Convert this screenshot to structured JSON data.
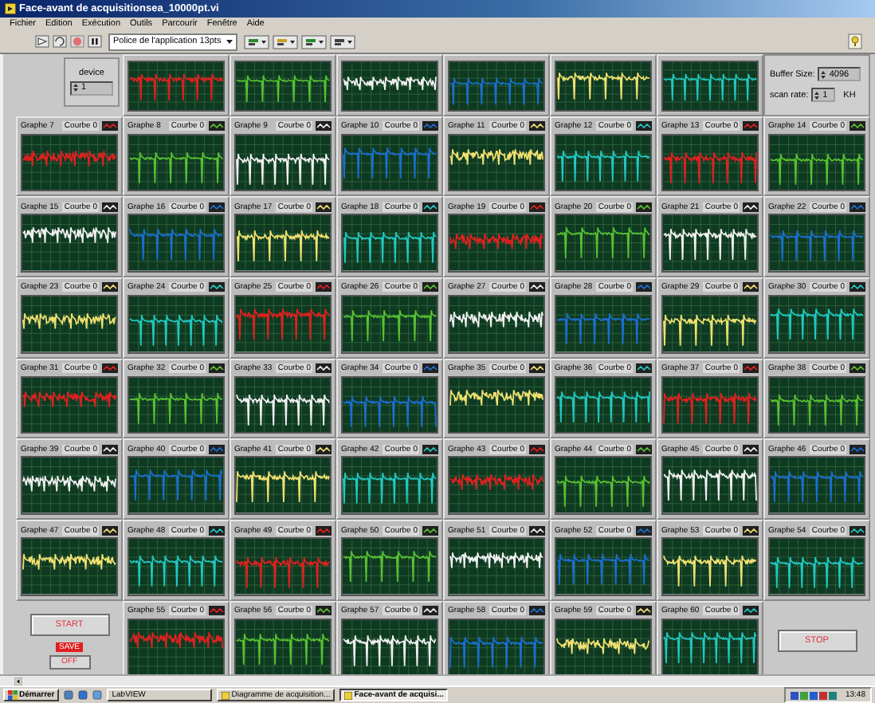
{
  "window": {
    "title": "Face-avant de acquisitionsea_10000pt.vi"
  },
  "menu": [
    "Fichier",
    "Edition",
    "Exécution",
    "Outils",
    "Parcourir",
    "Fenêtre",
    "Aide"
  ],
  "toolbar": {
    "font": "Police de l'application 13pts"
  },
  "device": {
    "label": "device",
    "value": "1"
  },
  "acquisition": {
    "buffer_label": "Buffer Size:",
    "buffer_value": "4096",
    "rate_label": "scan rate:",
    "rate_value": "1",
    "rate_unit": "KH"
  },
  "top_graphs": [
    {
      "color": "#e02020"
    },
    {
      "color": "#58c030"
    },
    {
      "color": "#f0f0f0"
    },
    {
      "color": "#1a6fd0"
    },
    {
      "color": "#f0e070"
    },
    {
      "color": "#20c8c0"
    }
  ],
  "graphs": [
    {
      "title": "Graphe 7",
      "legend": "Courbe 0",
      "color": "#e02020"
    },
    {
      "title": "Graphe 8",
      "legend": "Courbe 0",
      "color": "#58c030"
    },
    {
      "title": "Graphe 9",
      "legend": "Courbe 0",
      "color": "#f0f0f0"
    },
    {
      "title": "Graphe 10",
      "legend": "Courbe 0",
      "color": "#1a6fd0"
    },
    {
      "title": "Graphe 11",
      "legend": "Courbe 0",
      "color": "#f0e070"
    },
    {
      "title": "Graphe 12",
      "legend": "Courbe 0",
      "color": "#20c8c0"
    },
    {
      "title": "Graphe 13",
      "legend": "Courbe 0",
      "color": "#e02020"
    },
    {
      "title": "Graphe 14",
      "legend": "Courbe 0",
      "color": "#58c030"
    },
    {
      "title": "Graphe 15",
      "legend": "Courbe 0",
      "color": "#f0f0f0"
    },
    {
      "title": "Graphe 16",
      "legend": "Courbe 0",
      "color": "#1a6fd0"
    },
    {
      "title": "Graphe 17",
      "legend": "Courbe 0",
      "color": "#f0e070"
    },
    {
      "title": "Graphe 18",
      "legend": "Courbe 0",
      "color": "#20c8c0"
    },
    {
      "title": "Graphe 19",
      "legend": "Courbe 0",
      "color": "#e02020"
    },
    {
      "title": "Graphe 20",
      "legend": "Courbe 0",
      "color": "#58c030"
    },
    {
      "title": "Graphe 21",
      "legend": "Courbe 0",
      "color": "#f0f0f0"
    },
    {
      "title": "Graphe 22",
      "legend": "Courbe 0",
      "color": "#1a6fd0"
    },
    {
      "title": "Graphe 23",
      "legend": "Courbe 0",
      "color": "#f0e070"
    },
    {
      "title": "Graphe 24",
      "legend": "Courbe 0",
      "color": "#20c8c0"
    },
    {
      "title": "Graphe 25",
      "legend": "Courbe 0",
      "color": "#e02020"
    },
    {
      "title": "Graphe 26",
      "legend": "Courbe 0",
      "color": "#58c030"
    },
    {
      "title": "Graphe 27",
      "legend": "Courbe 0",
      "color": "#f0f0f0"
    },
    {
      "title": "Graphe 28",
      "legend": "Courbe 0",
      "color": "#1a6fd0"
    },
    {
      "title": "Graphe 29",
      "legend": "Courbe 0",
      "color": "#f0e070"
    },
    {
      "title": "Graphe 30",
      "legend": "Courbe 0",
      "color": "#20c8c0"
    },
    {
      "title": "Graphe 31",
      "legend": "Courbe 0",
      "color": "#e02020"
    },
    {
      "title": "Graphe 32",
      "legend": "Courbe 0",
      "color": "#58c030"
    },
    {
      "title": "Graphe 33",
      "legend": "Courbe 0",
      "color": "#f0f0f0"
    },
    {
      "title": "Graphe 34",
      "legend": "Courbe 0",
      "color": "#1a6fd0"
    },
    {
      "title": "Graphe 35",
      "legend": "Courbe 0",
      "color": "#f0e070"
    },
    {
      "title": "Graphe 36",
      "legend": "Courbe 0",
      "color": "#20c8c0"
    },
    {
      "title": "Graphe 37",
      "legend": "Courbe 0",
      "color": "#e02020"
    },
    {
      "title": "Graphe 38",
      "legend": "Courbe 0",
      "color": "#58c030"
    },
    {
      "title": "Graphe 39",
      "legend": "Courbe 0",
      "color": "#f0f0f0"
    },
    {
      "title": "Graphe 40",
      "legend": "Courbe 0",
      "color": "#1a6fd0"
    },
    {
      "title": "Graphe 41",
      "legend": "Courbe 0",
      "color": "#f0e070"
    },
    {
      "title": "Graphe 42",
      "legend": "Courbe 0",
      "color": "#20c8c0"
    },
    {
      "title": "Graphe 43",
      "legend": "Courbe 0",
      "color": "#e02020"
    },
    {
      "title": "Graphe 44",
      "legend": "Courbe 0",
      "color": "#58c030"
    },
    {
      "title": "Graphe 45",
      "legend": "Courbe 0",
      "color": "#f0f0f0"
    },
    {
      "title": "Graphe 46",
      "legend": "Courbe 0",
      "color": "#1a6fd0"
    },
    {
      "title": "Graphe 47",
      "legend": "Courbe 0",
      "color": "#f0e070"
    },
    {
      "title": "Graphe 48",
      "legend": "Courbe 0",
      "color": "#20c8c0"
    },
    {
      "title": "Graphe 49",
      "legend": "Courbe 0",
      "color": "#e02020"
    },
    {
      "title": "Graphe 50",
      "legend": "Courbe 0",
      "color": "#58c030"
    },
    {
      "title": "Graphe 51",
      "legend": "Courbe 0",
      "color": "#f0f0f0"
    },
    {
      "title": "Graphe 52",
      "legend": "Courbe 0",
      "color": "#1a6fd0"
    },
    {
      "title": "Graphe 53",
      "legend": "Courbe 0",
      "color": "#f0e070"
    },
    {
      "title": "Graphe 54",
      "legend": "Courbe 0",
      "color": "#20c8c0"
    },
    {
      "title": "Graphe 55",
      "legend": "Courbe 0",
      "color": "#e02020"
    },
    {
      "title": "Graphe 56",
      "legend": "Courbe 0",
      "color": "#58c030"
    },
    {
      "title": "Graphe 57",
      "legend": "Courbe 0",
      "color": "#f0f0f0"
    },
    {
      "title": "Graphe 58",
      "legend": "Courbe 0",
      "color": "#1a6fd0"
    },
    {
      "title": "Graphe 59",
      "legend": "Courbe 0",
      "color": "#f0e070"
    },
    {
      "title": "Graphe 60",
      "legend": "Courbe 0",
      "color": "#20c8c0"
    }
  ],
  "controls": {
    "start": "START",
    "save": "SAVE",
    "off": "OFF",
    "stop": "STOP"
  },
  "taskbar": {
    "start": "Démarrer",
    "items": [
      {
        "label": "LabVIEW",
        "selected": false
      },
      {
        "label": "Diagramme de acquisition...",
        "selected": false
      },
      {
        "label": "Face-avant de acquisi...",
        "selected": true
      }
    ],
    "clock": "13:48"
  }
}
